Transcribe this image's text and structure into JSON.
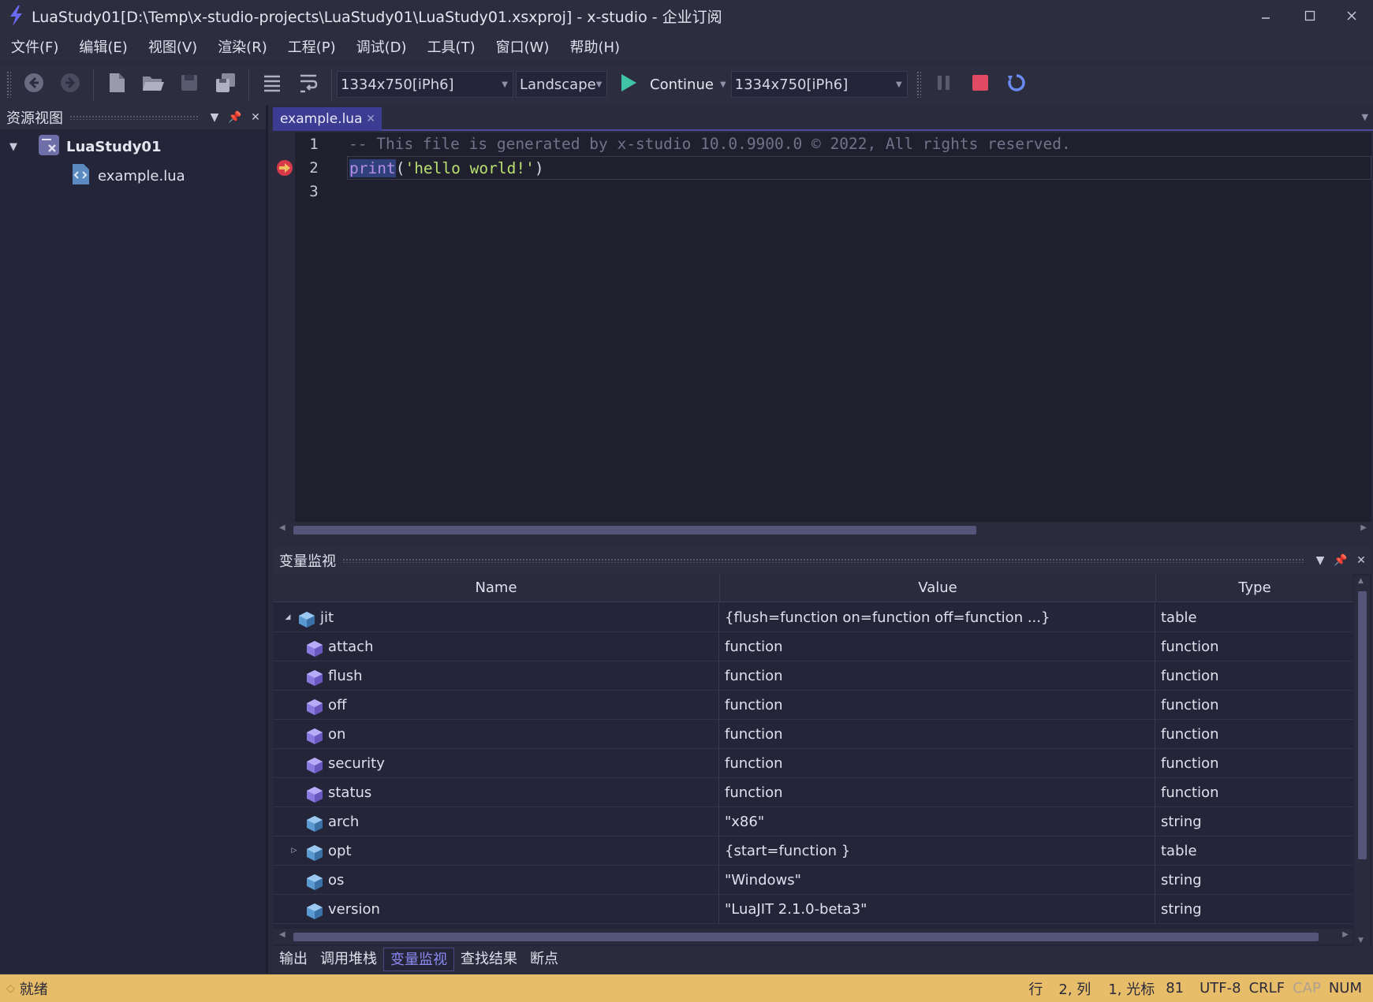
{
  "window": {
    "title": "LuaStudy01[D:\\Temp\\x-studio-projects\\LuaStudy01\\LuaStudy01.xsxproj] -  x-studio - 企业订阅",
    "accent": "#4a4aa0"
  },
  "menu": [
    "文件(F)",
    "编辑(E)",
    "视图(V)",
    "渲染(R)",
    "工程(P)",
    "调试(D)",
    "工具(T)",
    "窗口(W)",
    "帮助(H)"
  ],
  "toolbar": {
    "resolution": "1334x750[iPh6]",
    "orientation": "Landscape",
    "continue_label": "Continue",
    "device": "1334x750[iPh6]"
  },
  "resource_panel": {
    "title": "资源视图",
    "project": "LuaStudy01",
    "file": "example.lua"
  },
  "editor": {
    "tab": "example.lua",
    "line_numbers": [
      "1",
      "2",
      "3"
    ],
    "line1": "-- This file is generated by x-studio 10.0.9900.0 © 2022, All rights reserved.",
    "line2_func": "print",
    "line2_open": "(",
    "line2_str": "'hello world!'",
    "line2_close": ")",
    "line3": ""
  },
  "watch_panel": {
    "title": "变量监视",
    "columns": {
      "name": "Name",
      "value": "Value",
      "type": "Type"
    },
    "rows": [
      {
        "name": "jit",
        "value": "{flush=function on=function off=function ...}",
        "type": "table"
      },
      {
        "name": "attach",
        "value": "function",
        "type": "function"
      },
      {
        "name": "flush",
        "value": "function",
        "type": "function"
      },
      {
        "name": "off",
        "value": "function",
        "type": "function"
      },
      {
        "name": "on",
        "value": "function",
        "type": "function"
      },
      {
        "name": "security",
        "value": "function",
        "type": "function"
      },
      {
        "name": "status",
        "value": "function",
        "type": "function"
      },
      {
        "name": "arch",
        "value": "\"x86\"",
        "type": "string"
      },
      {
        "name": "opt",
        "value": "{start=function }",
        "type": "table"
      },
      {
        "name": "os",
        "value": "\"Windows\"",
        "type": "string"
      },
      {
        "name": "version",
        "value": "\"LuaJIT 2.1.0-beta3\"",
        "type": "string"
      }
    ]
  },
  "bottom_tabs": [
    "输出",
    "调用堆栈",
    "变量监视",
    "查找结果",
    "断点"
  ],
  "status": {
    "ready": "就绪",
    "row_label": "行",
    "row_value": "2, 列",
    "col_value": "1, 光标",
    "cursor_value": "81",
    "encoding": "UTF-8",
    "eol": "CRLF",
    "caps": "CAP",
    "num": "NUM",
    "bar_color": "#e8bd6a"
  }
}
